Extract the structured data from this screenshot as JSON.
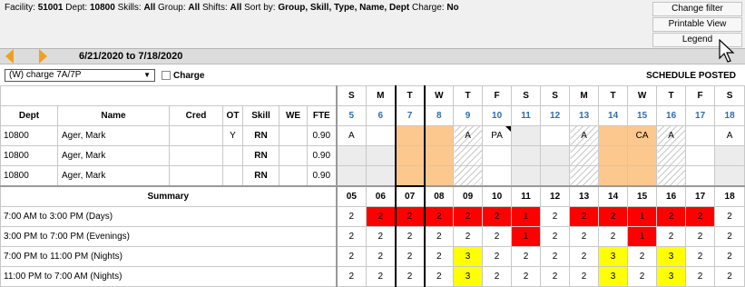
{
  "filters": [
    {
      "label": "Facility:",
      "value": "51001"
    },
    {
      "label": "Dept:",
      "value": "10800"
    },
    {
      "label": "Skills:",
      "value": "All"
    },
    {
      "label": "Group:",
      "value": "All"
    },
    {
      "label": "Shifts:",
      "value": "All"
    },
    {
      "label": "Sort by:",
      "value": "Group, Skill, Type, Name, Dept"
    },
    {
      "label": "Charge:",
      "value": "No"
    }
  ],
  "toolbar": {
    "change_filter": "Change filter",
    "printable_view": "Printable View",
    "legend": "Legend"
  },
  "date_range": "6/21/2020 to 7/18/2020",
  "shift_select": "(W)  charge 7A/7P",
  "charge_label": "Charge",
  "schedule_status": "SCHEDULE POSTED",
  "columns": {
    "dept": "Dept",
    "name": "Name",
    "cred": "Cred",
    "ot": "OT",
    "skill": "Skill",
    "we": "WE",
    "fte": "FTE"
  },
  "days": {
    "dow": [
      "S",
      "M",
      "T",
      "W",
      "T",
      "F",
      "S",
      "S",
      "M",
      "T",
      "W",
      "T",
      "F",
      "S"
    ],
    "num": [
      "5",
      "6",
      "7",
      "8",
      "9",
      "10",
      "11",
      "12",
      "13",
      "14",
      "15",
      "16",
      "17",
      "18"
    ]
  },
  "staff": [
    {
      "dept": "10800",
      "name": "Ager, Mark",
      "cred": "",
      "ot": "Y",
      "skill": "RN",
      "we": "",
      "fte": "0.90",
      "cells": [
        "A",
        "",
        "",
        "",
        "A",
        "PA",
        "",
        "",
        "A",
        "",
        "CA",
        "A",
        "",
        "A"
      ],
      "styles": [
        "",
        "",
        "orange",
        "orange",
        "hatch",
        "",
        "gray",
        "",
        "hatch",
        "orange",
        "orange",
        "hatch",
        "",
        ""
      ],
      "flag": [
        false,
        false,
        false,
        false,
        false,
        true,
        false,
        false,
        false,
        false,
        false,
        false,
        false,
        false
      ]
    },
    {
      "dept": "10800",
      "name": "Ager, Mark",
      "cred": "",
      "ot": "",
      "skill": "RN",
      "we": "",
      "fte": "0.90",
      "cells": [
        "",
        "",
        "",
        "",
        "",
        "",
        "",
        "",
        "",
        "",
        "",
        "",
        "",
        ""
      ],
      "styles": [
        "gray",
        "gray",
        "orange",
        "orange",
        "hatch",
        "",
        "gray",
        "gray",
        "hatch",
        "orange",
        "orange",
        "hatch",
        "",
        "gray"
      ],
      "flag": [
        false,
        false,
        false,
        false,
        false,
        false,
        false,
        false,
        false,
        false,
        false,
        false,
        false,
        false
      ]
    },
    {
      "dept": "10800",
      "name": "Ager, Mark",
      "cred": "",
      "ot": "",
      "skill": "RN",
      "we": "",
      "fte": "0.90",
      "cells": [
        "",
        "",
        "",
        "",
        "",
        "",
        "",
        "",
        "",
        "",
        "",
        "",
        "",
        ""
      ],
      "styles": [
        "gray",
        "gray",
        "orange",
        "orange",
        "hatch",
        "",
        "gray",
        "gray",
        "hatch",
        "orange",
        "orange",
        "hatch",
        "",
        "gray"
      ],
      "flag": [
        false,
        false,
        false,
        false,
        false,
        false,
        false,
        false,
        false,
        false,
        false,
        false,
        false,
        false
      ]
    }
  ],
  "summary": {
    "title": "Summary",
    "header": [
      "05",
      "06",
      "07",
      "08",
      "09",
      "10",
      "11",
      "12",
      "13",
      "14",
      "15",
      "16",
      "17",
      "18"
    ],
    "rows": [
      {
        "label": "7:00 AM to 3:00 PM (Days)",
        "values": [
          "2",
          "2",
          "2",
          "2",
          "2",
          "2",
          "1",
          "2",
          "2",
          "2",
          "1",
          "2",
          "2",
          "2"
        ],
        "colors": [
          "",
          "red",
          "red",
          "red",
          "red",
          "red",
          "red",
          "",
          "red",
          "red",
          "red",
          "red",
          "red",
          ""
        ]
      },
      {
        "label": "3:00 PM to 7:00 PM (Evenings)",
        "values": [
          "2",
          "2",
          "2",
          "2",
          "2",
          "2",
          "1",
          "2",
          "2",
          "2",
          "1",
          "2",
          "2",
          "2"
        ],
        "colors": [
          "",
          "",
          "",
          "",
          "",
          "",
          "red",
          "",
          "",
          "",
          "red",
          "",
          "",
          ""
        ]
      },
      {
        "label": "7:00 PM to 11:00 PM (Nights)",
        "values": [
          "2",
          "2",
          "2",
          "2",
          "3",
          "2",
          "2",
          "2",
          "2",
          "3",
          "2",
          "3",
          "2",
          "2"
        ],
        "colors": [
          "",
          "",
          "",
          "",
          "yellow",
          "",
          "",
          "",
          "",
          "yellow",
          "",
          "yellow",
          "",
          ""
        ]
      },
      {
        "label": "11:00 PM to 7:00 AM (Nights)",
        "values": [
          "2",
          "2",
          "2",
          "2",
          "3",
          "2",
          "2",
          "2",
          "2",
          "3",
          "2",
          "3",
          "2",
          "2"
        ],
        "colors": [
          "",
          "",
          "",
          "",
          "yellow",
          "",
          "",
          "",
          "",
          "yellow",
          "",
          "yellow",
          "",
          ""
        ]
      }
    ]
  },
  "colors": {
    "shortage": "#ff0000",
    "overage": "#ffff00",
    "request": "#fdc88e",
    "day_number": "#2f6bb5"
  }
}
